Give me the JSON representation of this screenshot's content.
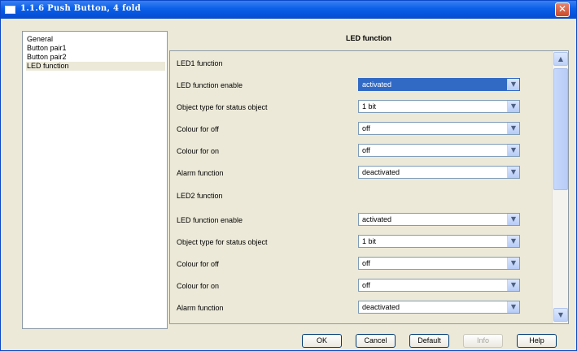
{
  "window": {
    "title": "1.1.6 Push Button, 4 fold"
  },
  "nav": {
    "items": [
      {
        "label": "General",
        "selected": false
      },
      {
        "label": "Button pair1",
        "selected": false
      },
      {
        "label": "Button pair2",
        "selected": false
      },
      {
        "label": "LED function",
        "selected": true
      }
    ]
  },
  "panel": {
    "title": "LED function",
    "rows": [
      {
        "label": "LED1 function"
      },
      {
        "label": "LED function enable",
        "value": "activated",
        "focused": true
      },
      {
        "label": "Object type for status object",
        "value": "1 bit"
      },
      {
        "label": "Colour for off",
        "value": "off"
      },
      {
        "label": "Colour for on",
        "value": "off"
      },
      {
        "label": "Alarm function",
        "value": "deactivated"
      },
      {
        "label": "LED2 function"
      },
      {
        "label": "LED function enable",
        "value": "activated"
      },
      {
        "label": "Object type for status object",
        "value": "1 bit"
      },
      {
        "label": "Colour for off",
        "value": "off"
      },
      {
        "label": "Colour for on",
        "value": "off"
      },
      {
        "label": "Alarm function",
        "value": "deactivated"
      }
    ]
  },
  "buttons": {
    "ok": "OK",
    "cancel": "Cancel",
    "default": "Default",
    "info": "Info",
    "help": "Help"
  }
}
